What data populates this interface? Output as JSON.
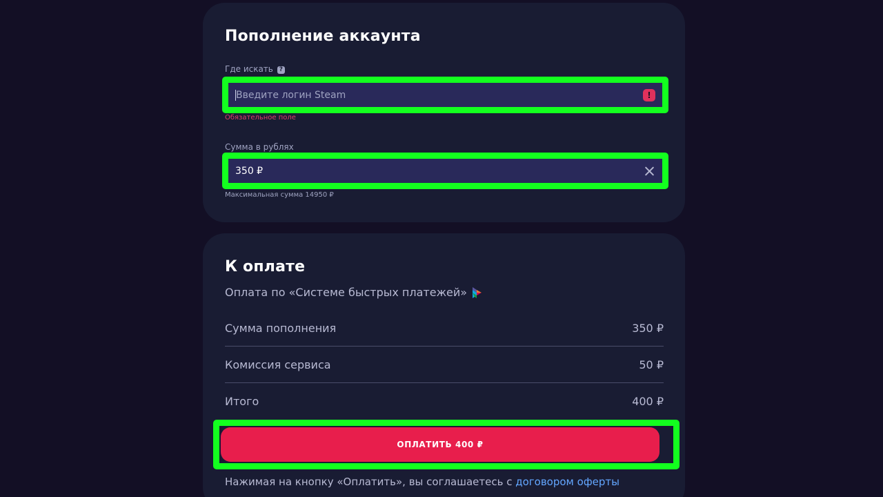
{
  "topup": {
    "title": "Пополнение аккаунта",
    "login_label": "Где искать",
    "login_placeholder": "Введите логин Steam",
    "login_error": "Обязательное поле",
    "amount_label": "Сумма в рублях",
    "amount_value": "350 ₽",
    "amount_hint": "Максимальная сумма 14950 ₽"
  },
  "payment": {
    "title": "К оплате",
    "method": "Оплата по «Системе быстрых платежей»",
    "rows": [
      {
        "label": "Сумма пополнения",
        "value": "350 ₽"
      },
      {
        "label": "Комиссия сервиса",
        "value": "50 ₽"
      },
      {
        "label": "Итого",
        "value": "400 ₽"
      }
    ],
    "pay_button": "ОПЛАТИТЬ 400 ₽",
    "agreement_text": "Нажимая на кнопку «Оплатить», вы соглашаетесь с ",
    "agreement_link": "договором оферты"
  },
  "icons": {
    "help": "help-icon",
    "error": "error-icon",
    "clear": "clear-icon",
    "sbp": "sbp-logo"
  },
  "colors": {
    "accent": "#e81e4c",
    "highlight": "#13ff1f",
    "link": "#63a6ff",
    "error": "#e0426b"
  }
}
